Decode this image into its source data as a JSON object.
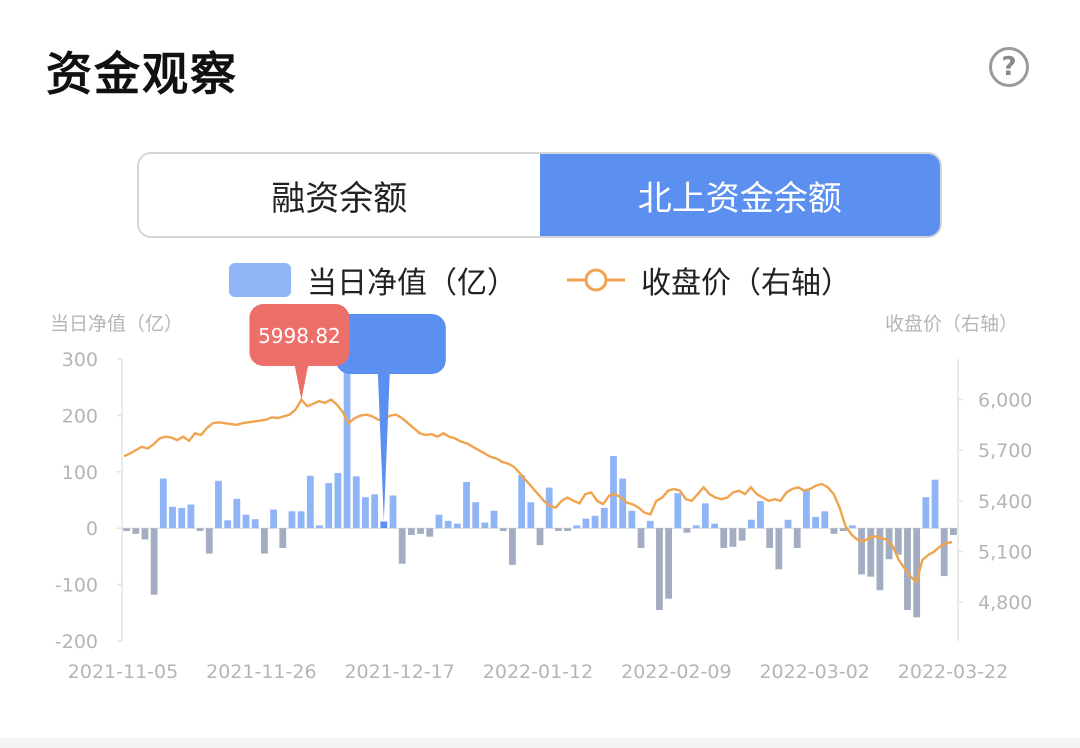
{
  "header": {
    "title": "资金观察",
    "help_icon": "?"
  },
  "tabs": [
    {
      "label": "融资余额",
      "active": false
    },
    {
      "label": "北上资金余额",
      "active": true
    }
  ],
  "legend": {
    "bar_label": "当日净值（亿）",
    "line_label": "收盘价（右轴）"
  },
  "colors": {
    "positive_bar": "#8fb5f6",
    "negative_bar": "#a3adc2",
    "line": "#f0a450",
    "highlight_bar": "#5b8ff0",
    "tooltip": "#ec6f6a",
    "axis_text": "#b5b5b5"
  },
  "chart_data": {
    "type": "bar",
    "y_left_label": "当日净值（亿）",
    "y_right_label": "收盘价（右轴）",
    "y_left_ticks": [
      "300",
      "200",
      "100",
      "0",
      "-100",
      "-200"
    ],
    "y_left_range": [
      -200,
      300
    ],
    "y_right_ticks": [
      "6,000",
      "5,700",
      "5,400",
      "5,100",
      "4,800"
    ],
    "y_right_range": [
      4570,
      6240
    ],
    "x_tick_labels": [
      "2021-11-05",
      "2021-11-26",
      "2021-12-17",
      "2022-01-12",
      "2022-02-09",
      "2022-03-02",
      "2022-03-22"
    ],
    "tooltip_value": "5998.82",
    "highlight_index": 28,
    "series": [
      {
        "name": "当日净值（亿）",
        "type": "bar",
        "values": [
          -5,
          -10,
          -20,
          -118,
          88,
          38,
          36,
          42,
          -5,
          -45,
          84,
          14,
          52,
          24,
          16,
          -45,
          33,
          -35,
          30,
          30,
          93,
          5,
          80,
          98,
          330,
          92,
          55,
          60,
          12,
          58,
          -63,
          -12,
          -10,
          -15,
          24,
          13,
          8,
          82,
          46,
          10,
          31,
          -5,
          -65,
          94,
          46,
          -30,
          72,
          -5,
          -5,
          5,
          17,
          22,
          36,
          128,
          88,
          31,
          -35,
          13,
          -145,
          -125,
          62,
          -8,
          5,
          44,
          8,
          -35,
          -33,
          -22,
          15,
          48,
          -35,
          -73,
          15,
          -35,
          67,
          20,
          30,
          -10,
          -5,
          5,
          -82,
          -86,
          -110,
          -55,
          -47,
          -145,
          -158,
          55,
          86,
          -85,
          -12
        ]
      },
      {
        "name": "收盘价（右轴）",
        "type": "line",
        "values": [
          5665,
          5680,
          5700,
          5720,
          5710,
          5735,
          5770,
          5780,
          5775,
          5760,
          5780,
          5755,
          5800,
          5790,
          5830,
          5860,
          5865,
          5860,
          5855,
          5850,
          5860,
          5865,
          5870,
          5875,
          5880,
          5895,
          5890,
          5900,
          5910,
          5940,
          5999,
          5960,
          5975,
          5990,
          5980,
          6000,
          5970,
          5925,
          5860,
          5890,
          5905,
          5910,
          5900,
          5880,
          5885,
          5905,
          5910,
          5890,
          5860,
          5830,
          5800,
          5790,
          5795,
          5780,
          5800,
          5780,
          5770,
          5750,
          5740,
          5720,
          5700,
          5680,
          5660,
          5650,
          5630,
          5620,
          5600,
          5560,
          5520,
          5480,
          5440,
          5400,
          5370,
          5360,
          5400,
          5420,
          5400,
          5385,
          5440,
          5450,
          5400,
          5380,
          5430,
          5440,
          5420,
          5390,
          5380,
          5360,
          5330,
          5320,
          5400,
          5420,
          5460,
          5470,
          5460,
          5410,
          5400,
          5440,
          5480,
          5440,
          5420,
          5410,
          5420,
          5450,
          5460,
          5440,
          5480,
          5440,
          5420,
          5400,
          5410,
          5400,
          5450,
          5470,
          5480,
          5460,
          5470,
          5490,
          5500,
          5480,
          5440,
          5360,
          5250,
          5200,
          5170,
          5160,
          5180,
          5190,
          5180,
          5170,
          5130,
          5050,
          5000,
          4950,
          4920,
          5050,
          5080,
          5100,
          5130,
          5150,
          5155
        ]
      }
    ]
  }
}
